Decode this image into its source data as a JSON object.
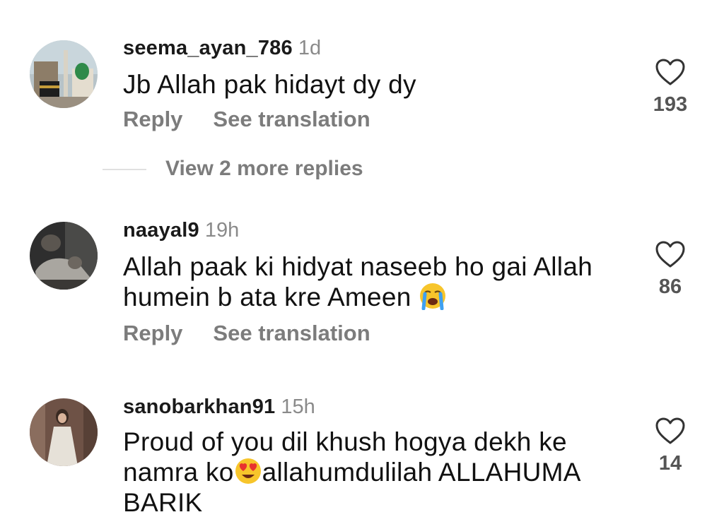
{
  "comments": [
    {
      "username": "seema_ayan_786",
      "time": "1d",
      "text": "Jb Allah pak hidayt dy dy",
      "likes": "193",
      "reply_label": "Reply",
      "translate_label": "See translation"
    },
    {
      "username": "naayal9",
      "time": "19h",
      "text_line1": "Allah paak ki hidyat naseeb ho gai Allah",
      "text_line2": "humein b ata kre Ameen",
      "emoji": "crying-face",
      "likes": "86",
      "reply_label": "Reply",
      "translate_label": "See translation"
    },
    {
      "username": "sanobarkhan91",
      "time": "15h",
      "text_line1": "Proud of you dil khush hogya dekh ke",
      "text_line2a": "namra ko",
      "text_line2b": "allahumdulilah ALLAHUMA",
      "text_line3": "BARIK",
      "emoji": "heart-eyes-face",
      "likes": "14"
    }
  ],
  "view_more_replies": "View 2 more replies"
}
